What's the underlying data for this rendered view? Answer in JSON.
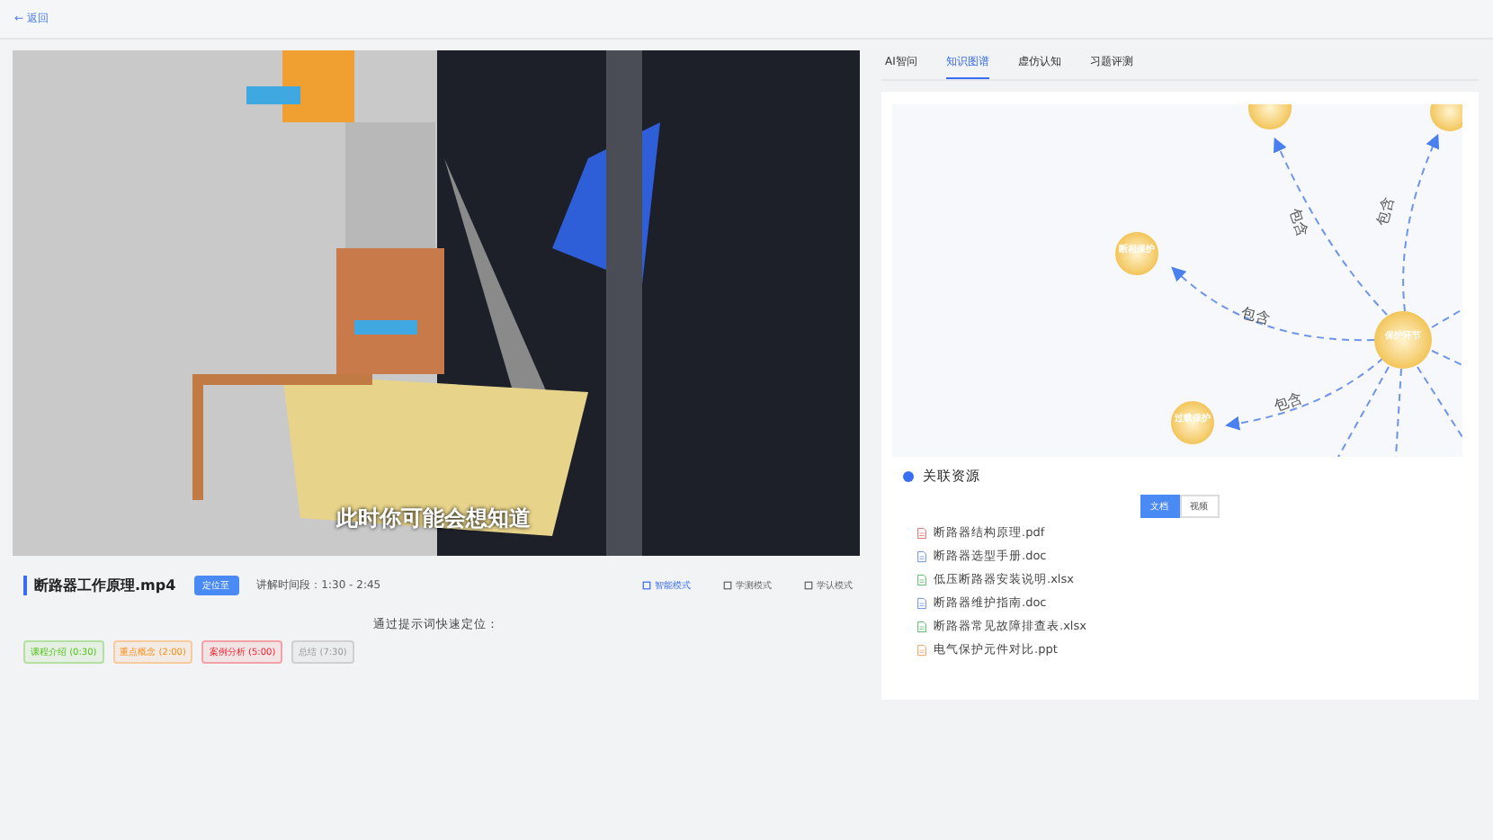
{
  "back_link": "← 返回",
  "video": {
    "subtitle": "此时你可能会想知道"
  },
  "video_info": {
    "title": "断路器工作原理.mp4",
    "badge": "定位至",
    "time_range": "讲解时间段：1:30 - 2:45",
    "modes": [
      {
        "label": "智能模式",
        "selected": true
      },
      {
        "label": "学测模式",
        "selected": false
      },
      {
        "label": "学认模式",
        "selected": false
      }
    ]
  },
  "hint_title": "通过提示词快速定位：",
  "chips": [
    {
      "label": "课程介绍 (0:30)",
      "color": "#52c41a"
    },
    {
      "label": "重点概念 (2:00)",
      "color": "#fa8c16"
    },
    {
      "label": "案例分析 (5:00)",
      "color": "#f5222d"
    },
    {
      "label": "总结 (7:30)",
      "color": "#999999"
    }
  ],
  "tabs": [
    {
      "label": "AI智问",
      "selected": false
    },
    {
      "label": "知识图谱",
      "selected": true
    },
    {
      "label": "虚仿认知",
      "selected": false
    },
    {
      "label": "习题评测",
      "selected": false
    }
  ],
  "graph": {
    "nodes": [
      {
        "label": "断相保护"
      },
      {
        "label": "保护环节"
      },
      {
        "label": "过载保护"
      }
    ],
    "edge_labels": [
      "包含",
      "包含",
      "包含",
      "包含"
    ]
  },
  "resources": {
    "title": "关联资源",
    "toggle": [
      {
        "label": "文档",
        "selected": true
      },
      {
        "label": "视频",
        "selected": false
      }
    ],
    "files": [
      {
        "name": "断路器结构原理.pdf",
        "kind": "pdf"
      },
      {
        "name": "断路器选型手册.doc",
        "kind": "doc"
      },
      {
        "name": "低压断路器安装说明.xlsx",
        "kind": "sheet"
      },
      {
        "name": "断路器维护指南.doc",
        "kind": "doc"
      },
      {
        "name": "断路器常见故障排查表.xlsx",
        "kind": "sheet"
      },
      {
        "name": "电气保护元件对比.ppt",
        "kind": "slides"
      }
    ]
  }
}
